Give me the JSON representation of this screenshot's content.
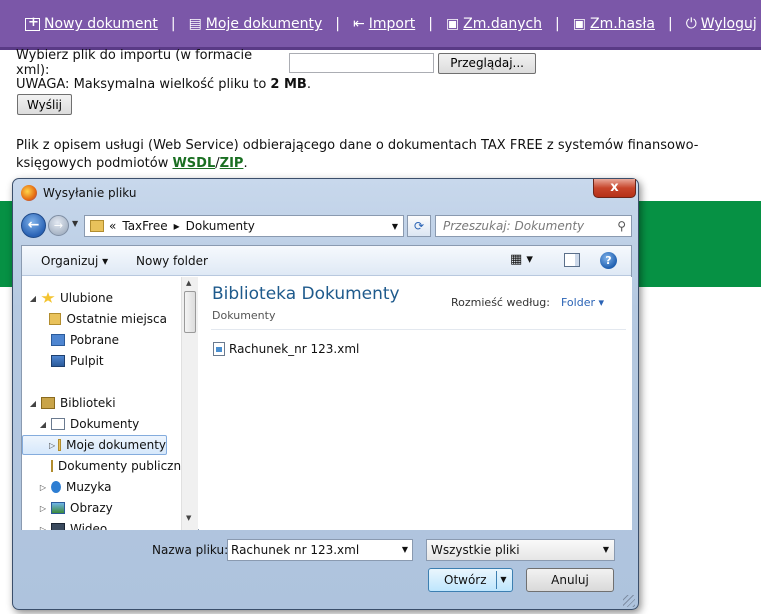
{
  "nav": {
    "items": [
      {
        "label": "Nowy dokument",
        "icon": "add-document-icon"
      },
      {
        "label": "Moje dokumenty",
        "icon": "document-icon"
      },
      {
        "label": "Import",
        "icon": "import-icon"
      },
      {
        "label": "Zm.danych",
        "icon": "id-card-icon"
      },
      {
        "label": "Zm.hasła",
        "icon": "id-card-icon"
      },
      {
        "label": "Wyloguj",
        "icon": "power-icon"
      }
    ],
    "separator": "|"
  },
  "import_form": {
    "prompt": "Wybierz plik do importu (w formacie xml):",
    "browse_label": "Przeglądaj...",
    "warning_prefix": "UWAGA: Maksymalna wielkość pliku to ",
    "warning_size": "2 MB",
    "warning_suffix": ".",
    "send_label": "Wyślij"
  },
  "description": {
    "text": "Plik z opisem usługi (Web Service) odbierającego dane o dokumentach TAX FREE z systemów finansowo-księgowych podmiotów ",
    "link1": "WSDL",
    "slash": "/",
    "link2": "ZIP",
    "end": "."
  },
  "dialog": {
    "title": "Wysyłanie pliku",
    "close": "x",
    "breadcrumb": [
      "«",
      "TaxFree",
      "▸",
      "Dokumenty"
    ],
    "search_placeholder": "Przeszukaj: Dokumenty",
    "organize_label": "Organizuj ▾",
    "new_folder_label": "Nowy folder",
    "view_label": "▦ ▾",
    "help_label": "?",
    "tree": [
      {
        "label": "Ulubione",
        "icon": "star-icon",
        "level": 0,
        "expander": "◢"
      },
      {
        "label": "Ostatnie miejsca",
        "icon": "recent-places-icon",
        "level": 1,
        "expander": ""
      },
      {
        "label": "Pobrane",
        "icon": "downloads-icon",
        "level": 1,
        "expander": ""
      },
      {
        "label": "Pulpit",
        "icon": "desktop-icon",
        "level": 1,
        "expander": ""
      },
      {
        "label": "Biblioteki",
        "icon": "libraries-icon",
        "level": 0,
        "expander": "◢"
      },
      {
        "label": "Dokumenty",
        "icon": "documents-icon",
        "level": 1,
        "expander": "◢"
      },
      {
        "label": "Moje dokumenty",
        "icon": "folder-icon",
        "level": 2,
        "expander": "▷",
        "selected": true
      },
      {
        "label": "Dokumenty publiczne",
        "icon": "folder-icon",
        "level": 2,
        "expander": ""
      },
      {
        "label": "Muzyka",
        "icon": "music-icon",
        "level": 1,
        "expander": "▷"
      },
      {
        "label": "Obrazy",
        "icon": "pictures-icon",
        "level": 1,
        "expander": "▷"
      },
      {
        "label": "Wideo",
        "icon": "video-icon",
        "level": 1,
        "expander": "▷"
      }
    ],
    "library_title": "Biblioteka Dokumenty",
    "library_subtitle": "Dokumenty",
    "arrange_label": "Rozmieść według:",
    "arrange_value": "Folder ▾",
    "files": [
      {
        "name": "Rachunek_nr 123.xml",
        "icon": "xml-file-icon"
      }
    ],
    "filename_label": "Nazwa pliku:",
    "filename_value": "Rachunek nr 123.xml",
    "filetype_value": "Wszystkie pliki",
    "open_label": "Otwórz",
    "cancel_label": "Anuluj"
  },
  "colors": {
    "nav_bg": "#7b57a8",
    "green_band": "#069144",
    "link_green": "#1a6f22",
    "library_title": "#1e5a8c"
  }
}
